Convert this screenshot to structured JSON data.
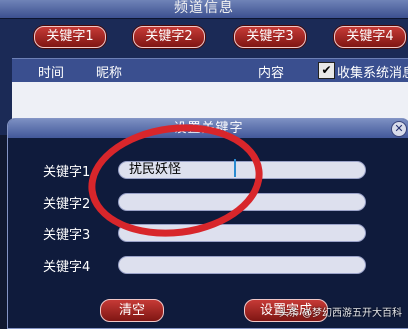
{
  "window": {
    "title": "频道信息"
  },
  "keyword_tabs": [
    "关键字1",
    "关键字2",
    "关键字3",
    "关键字4"
  ],
  "list": {
    "columns": {
      "time": "时间",
      "nickname": "昵称",
      "content": "内容"
    },
    "collect_checkbox": {
      "label": "收集系统消息",
      "checked": true,
      "check_mark": "✔"
    }
  },
  "dialog": {
    "title": "设置关键字",
    "close_glyph": "✕",
    "rows": [
      {
        "label": "关键字1",
        "value": "扰民妖怪"
      },
      {
        "label": "关键字2",
        "value": ""
      },
      {
        "label": "关键字3",
        "value": ""
      },
      {
        "label": "关键字4",
        "value": ""
      }
    ],
    "clear_button": "清空",
    "done_button": "设置完成"
  },
  "watermark": "头条 @梦幻西游五开大百科",
  "colors": {
    "accent_red": "#c63a36",
    "annotation_red": "#d8262b",
    "panel_blue": "#1b2a56"
  },
  "icons": {
    "close": "close-icon",
    "check": "check-icon"
  }
}
